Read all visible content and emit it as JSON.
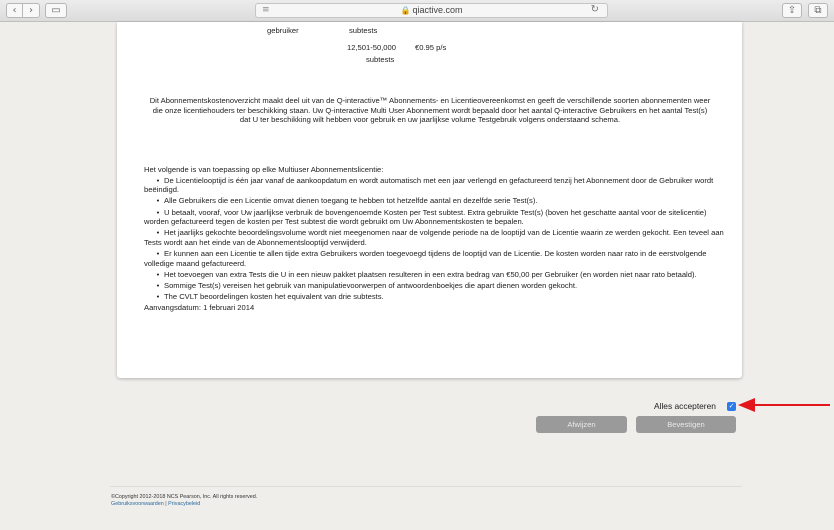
{
  "browser": {
    "url": "qiactive.com",
    "back_glyph": "‹",
    "forward_glyph": "›",
    "address_glyph": "≡",
    "reload_glyph": "↻",
    "sidebar_glyph": "▭",
    "share_glyph": "⇪",
    "tabs_glyph": "⧉",
    "lock_glyph": "🔒"
  },
  "tiers": {
    "row1_left": "gebruiker",
    "row1_right": "subtests",
    "row2_range": "12,501-50,000",
    "row2_price": "€0.95 p/s",
    "row3_unit": "subtests"
  },
  "intro_text": "Dit Abonnementskostenoverzicht  maakt deel uit van de Q-interactive™ Abonnements- en Licentieovereenkomst en geeft de verschillende soorten abonnementen weer die onze licentiehouders ter beschikking staan. Uw Q-interactive Multi User Abonnement wordt bepaald door het aantal Q-interactive Gebruikers en het aantal Test(s) dat U ter beschikking wilt hebben voor gebruik en uw jaarlijkse volume Testgebruik volgens onderstaand schema.",
  "applicable_heading": "Het volgende is van toepassing op elke Multiuser Abonnementslicentie:",
  "bullet_glyph": "•",
  "bullets": [
    "De Licentielooptijd is één jaar vanaf de aankoopdatum en wordt automatisch met een jaar verlengd en gefactureerd tenzij het Abonnement door de Gebruiker wordt beëindigd.",
    "Alle Gebruikers die een Licentie omvat dienen toegang te hebben tot hetzelfde aantal en dezelfde serie Test(s).",
    "U betaalt, vooraf, voor Uw jaarlijkse verbruik de bovengenoemde Kosten per Test subtest. Extra gebruikte Test(s) (boven het geschatte aantal voor de sitelicentie) worden gefactureerd tegen de kosten per Test subtest die wordt gebruikt om Uw Abonnementskosten te bepalen.",
    "Het jaarlijks gekochte beoordelingsvolume wordt niet meegenomen naar de volgende periode na de looptijd van de Licentie waarin ze werden gekocht. Een teveel aan Tests wordt aan het einde van de Abonnementslooptijd verwijderd.",
    "Er kunnen aan een Licentie te allen tijde extra Gebruikers worden toegevoegd tijdens de looptijd van de Licentie. De kosten worden naar rato in de eerstvolgende volledige maand gefactureerd.",
    "Het toevoegen van extra Tests die U in een nieuw pakket plaatsen resulteren in een extra bedrag van €50,00 per Gebruiker (en worden niet naar rato betaald).",
    "Sommige Test(s) vereisen het gebruik van manipulatievoorwerpen of antwoordenboekjes die apart dienen worden gekocht.",
    "The CVLT beoordelingen kosten het equivalent van drie subtests."
  ],
  "start_date": "Aanvangsdatum: 1 februari 2014",
  "accept_all_label": "Alles accepteren",
  "accept_checked": true,
  "checkmark_glyph": "✓",
  "reject_label": "Afwijzen",
  "confirm_label": "Bevestigen",
  "annotation_color": "#e3161b",
  "footer": {
    "copyright": "©Copyright 2012-2018 NCS Pearson, Inc. All rights reserved.",
    "terms_link": "Gebruiksvoorwaarden",
    "separator": "|",
    "privacy_link": "Privacybeleid"
  }
}
